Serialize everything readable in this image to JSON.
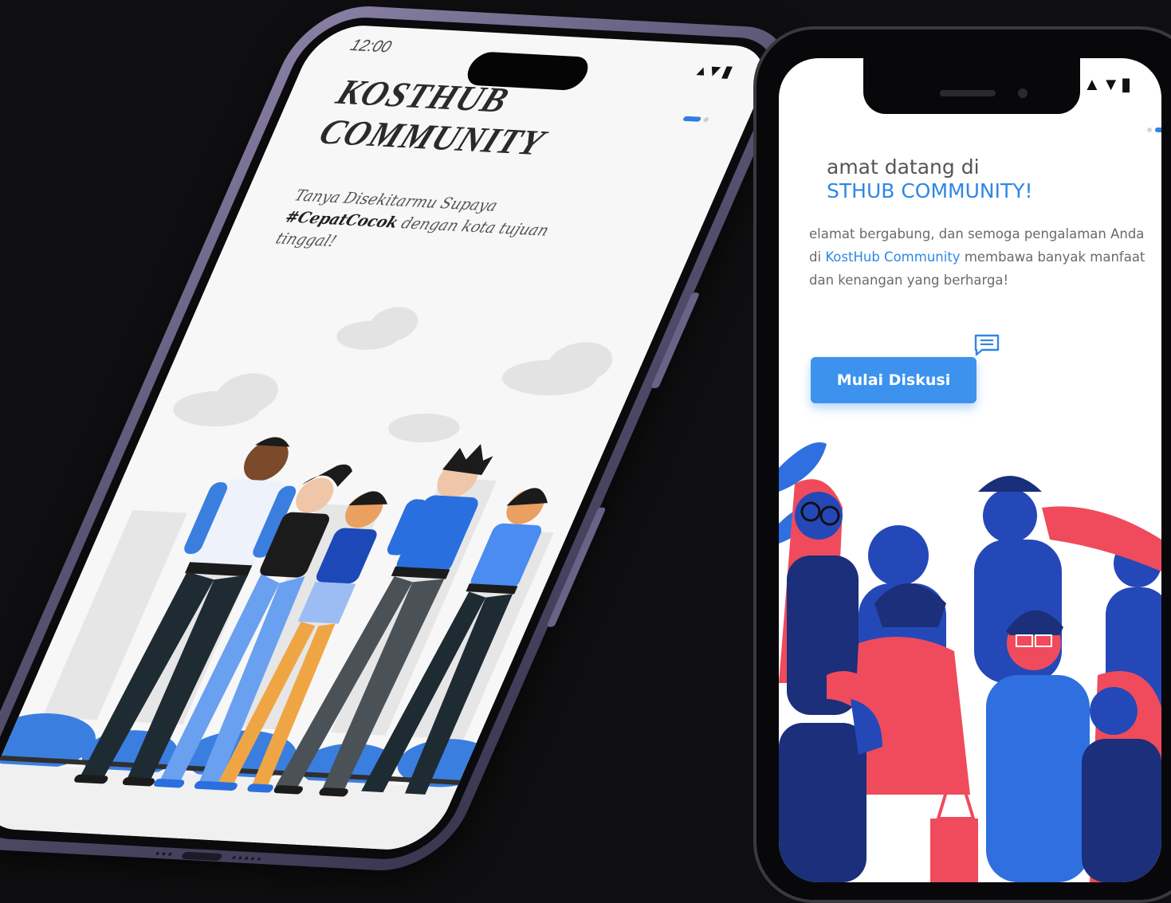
{
  "phone1": {
    "status_time": "12:00",
    "signal": "▴▼▮",
    "title_line1": "KOSTHUB",
    "title_line2": "COMMUNITY",
    "subtitle_prefix": "Tanya Disekitarmu Supaya",
    "subtitle_hashtag": "#CepatCocok",
    "subtitle_suffix": "dengan kota tujuan tinggal!",
    "pager_active_index": 0
  },
  "phone2": {
    "signal": "▲▼▮",
    "greeting": "amat datang di",
    "brand": "STHUB COMMUNITY!",
    "body_part1": "elamat bergabung, dan semoga pengalaman Anda di",
    "body_highlight": "KostHub Community",
    "body_part2": "membawa banyak manfaat dan kenangan yang berharga!",
    "button_label": "Mulai Diskusi",
    "pager_active_index": 1
  },
  "colors": {
    "accent_blue": "#2f86e6",
    "button_blue": "#3d92ee",
    "illus_red": "#ef4b5c",
    "illus_blue": "#2548b8",
    "background": "#0f0f11"
  },
  "icons": {
    "chat": "chat-bubble-icon"
  }
}
